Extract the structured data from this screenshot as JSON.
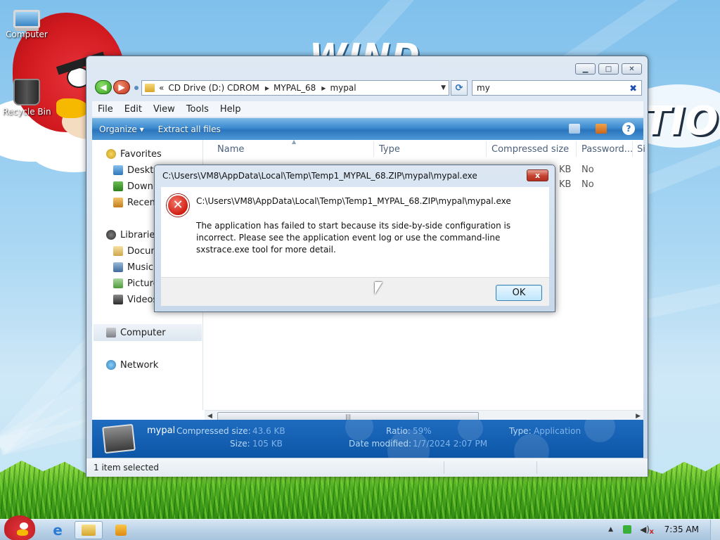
{
  "desktop": {
    "icons": [
      {
        "label": "Computer"
      },
      {
        "label": "Recycle Bin"
      }
    ]
  },
  "explorer": {
    "controls": {
      "minimize": "▁",
      "maximize": "□",
      "close": "✕"
    },
    "address": {
      "overflow": "«",
      "segments": [
        "CD Drive (D:) CDROM",
        "MYPAL_68",
        "mypal"
      ]
    },
    "search": {
      "value": "my"
    },
    "menu": [
      "File",
      "Edit",
      "View",
      "Tools",
      "Help"
    ],
    "toolbar": {
      "organize": "Organize ▾",
      "extract": "Extract all files",
      "help": "?"
    },
    "nav_pane": {
      "favorites": "Favorites",
      "favorites_items": [
        "Deskto",
        "Downl",
        "Recent"
      ],
      "libraries": "Libraries",
      "libraries_items": [
        "Docum",
        "Music",
        "Picture",
        "Videos"
      ],
      "computer": "Computer",
      "network": "Network"
    },
    "columns": [
      "Name",
      "Type",
      "Compressed size",
      "Password...",
      "Si"
    ],
    "rows": [
      {
        "size_unit": "KB",
        "password": "No"
      },
      {
        "size_unit": "KB",
        "password": "No"
      }
    ],
    "details": {
      "name": "mypal",
      "compressed_label": "Compressed size:",
      "compressed_value": "43.6 KB",
      "size_label": "Size:",
      "size_value": "105 KB",
      "ratio_label": "Ratio:",
      "ratio_value": "59%",
      "modified_label": "Date modified:",
      "modified_value": "1/7/2024 2:07 PM",
      "type_label": "Type:",
      "type_value": "Application"
    },
    "status": "1 item selected"
  },
  "dialog": {
    "title": "C:\\Users\\VM8\\AppData\\Local\\Temp\\Temp1_MYPAL_68.ZIP\\mypal\\mypal.exe",
    "path": "C:\\Users\\VM8\\AppData\\Local\\Temp\\Temp1_MYPAL_68.ZIP\\mypal\\mypal.exe",
    "message": "The application has failed to start because its side-by-side configuration is incorrect. Please see the application event log or use the command-line sxstrace.exe tool for more detail.",
    "ok": "OK",
    "close": "x"
  },
  "taskbar": {
    "clock": "7:35 AM"
  }
}
